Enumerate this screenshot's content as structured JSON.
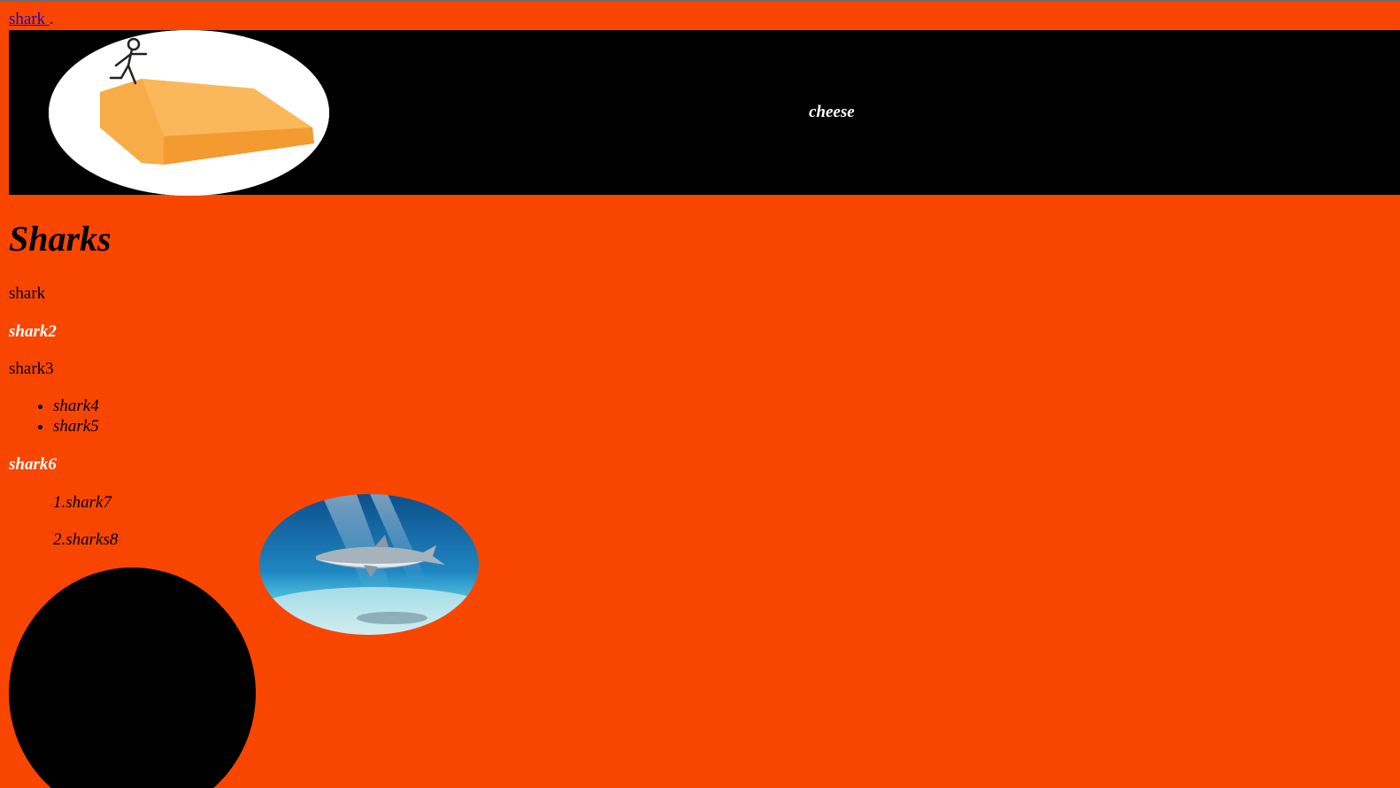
{
  "top_link": {
    "label": "shark ",
    "trailing": "."
  },
  "banner": {
    "title": "cheese",
    "image_icon": "cheese-wedge-image"
  },
  "main": {
    "heading": "Sharks",
    "p1": "shark",
    "p2": "shark2",
    "p3": "shark3",
    "bullets": [
      "shark4",
      "shark5"
    ],
    "p6": "shark6",
    "numbered": [
      "1.shark7",
      "2.sharks8"
    ],
    "shark_image_icon": "shark-underwater-image"
  },
  "colors": {
    "background": "#f84600",
    "banner": "#000000",
    "link": "#1a0dab"
  }
}
